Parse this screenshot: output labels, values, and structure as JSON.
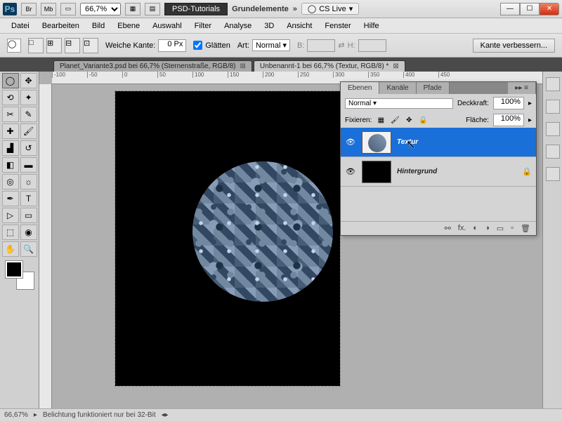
{
  "titlebar": {
    "zoom": "66,7%",
    "center": "PSD-Tutorials",
    "doc": "Grundelemente",
    "cslive": "CS Live"
  },
  "menu": [
    "Datei",
    "Bearbeiten",
    "Bild",
    "Ebene",
    "Auswahl",
    "Filter",
    "Analyse",
    "3D",
    "Ansicht",
    "Fenster",
    "Hilfe"
  ],
  "optbar": {
    "feather_label": "Weiche Kante:",
    "feather_val": "0 Px",
    "antialias": "Glätten",
    "style_label": "Art:",
    "style_val": "Normal",
    "w": "B:",
    "h": "H:",
    "refine": "Kante verbessern..."
  },
  "doctabs": [
    {
      "label": "Planet_Variante3.psd bei 66,7% (Sternenstraße, RGB/8)",
      "active": false
    },
    {
      "label": "Unbenannt-1 bei 66,7% (Textur, RGB/8) *",
      "active": true
    }
  ],
  "ruler": [
    "-100",
    "-50",
    "0",
    "50",
    "100",
    "150",
    "200",
    "250",
    "300",
    "350",
    "400",
    "450"
  ],
  "layers_panel": {
    "tabs": [
      "Ebenen",
      "Kanäle",
      "Pfade"
    ],
    "blend": "Normal",
    "opacity_label": "Deckkraft:",
    "opacity_val": "100%",
    "lock_label": "Fixieren:",
    "fill_label": "Fläche:",
    "fill_val": "100%",
    "layers": [
      {
        "name": "Textur",
        "selected": true,
        "bg": false
      },
      {
        "name": "Hintergrund",
        "selected": false,
        "bg": true
      }
    ]
  },
  "status": {
    "zoom": "66,67%",
    "msg": "Belichtung funktioniert nur bei 32-Bit"
  }
}
